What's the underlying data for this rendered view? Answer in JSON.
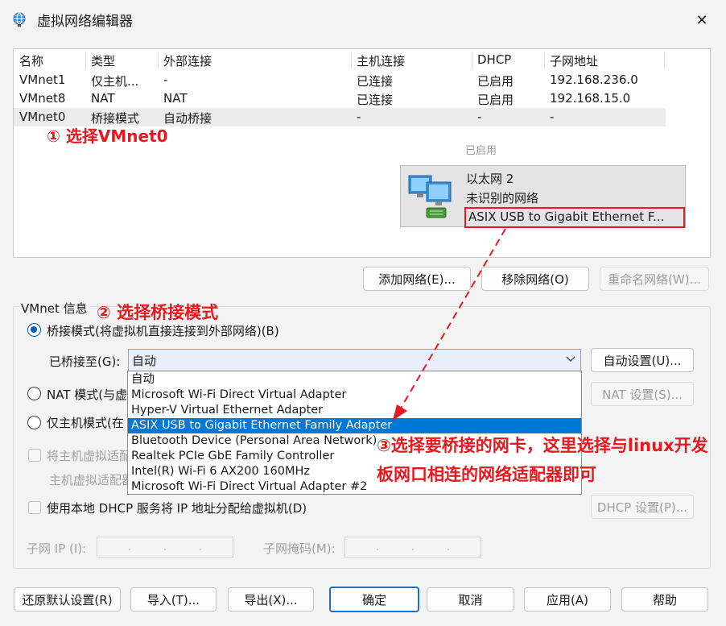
{
  "window": {
    "title": "虚拟网络编辑器",
    "close_symbol": "✕"
  },
  "network_list": {
    "headers": [
      "名称",
      "类型",
      "外部连接",
      "主机连接",
      "DHCP",
      "子网地址"
    ],
    "rows": [
      [
        "VMnet1",
        "仅主机...",
        "-",
        "已连接",
        "已启用",
        "192.168.236.0"
      ],
      [
        "VMnet8",
        "NAT",
        "NAT",
        "已连接",
        "已启用",
        "192.168.15.0"
      ],
      [
        "VMnet0",
        "桥接模式",
        "自动桥接",
        "-",
        "-",
        "-"
      ]
    ],
    "selected_row": 2,
    "faded_text": "已启用"
  },
  "adapter_card": {
    "name": "以太网 2",
    "status": "未识别的网络",
    "adapter": "ASIX USB to Gigabit Ethernet F..."
  },
  "annotations": {
    "step1": "① 选择VMnet0",
    "step2": "② 选择桥接模式",
    "step3": "③选择要桥接的网卡，这里选择与linux开发板网口相连的网络适配器即可",
    "color": "#e8191e"
  },
  "list_buttons": {
    "add": "添加网络(E)...",
    "remove": "移除网络(O)",
    "rename": "重命名网络(W)..."
  },
  "vmnet_info": {
    "label": "VMnet 信息",
    "bridged_radio": "桥接模式(将虚拟机直接连接到外部网络)(B)",
    "bridged_to_label": "已桥接至(G):",
    "bridged_to_value": "自动",
    "auto_settings": "自动设置(U)...",
    "nat_radio": "NAT 模式(与虚",
    "nat_settings": "NAT 设置(S)...",
    "host_radio": "仅主机模式(在",
    "connect_host_check": "将主机虚拟适配",
    "host_adapter_name": "主机虚拟适配器",
    "dhcp_check": "使用本地 DHCP 服务将 IP 地址分配给虚拟机(D)",
    "dhcp_settings": "DHCP 设置(P)...",
    "subnet_ip_label": "子网 IP (I):",
    "subnet_mask_label": "子网掩码(M):",
    "ip_dot": "."
  },
  "dropdown_options": [
    "自动",
    "Microsoft Wi-Fi Direct Virtual Adapter",
    "Hyper-V Virtual Ethernet Adapter",
    "ASIX USB to Gigabit Ethernet Family Adapter",
    "Bluetooth Device (Personal Area Network)",
    "Realtek PCIe GbE Family Controller",
    "Intel(R) Wi-Fi 6 AX200 160MHz",
    "Microsoft Wi-Fi Direct Virtual Adapter #2"
  ],
  "dropdown_selected": 3,
  "bottom_buttons": {
    "restore": "还原默认设置(R)",
    "import": "导入(T)...",
    "export": "导出(X)...",
    "ok": "确定",
    "cancel": "取消",
    "apply": "应用(A)",
    "help": "帮助"
  },
  "accent_color": "#0078d7"
}
